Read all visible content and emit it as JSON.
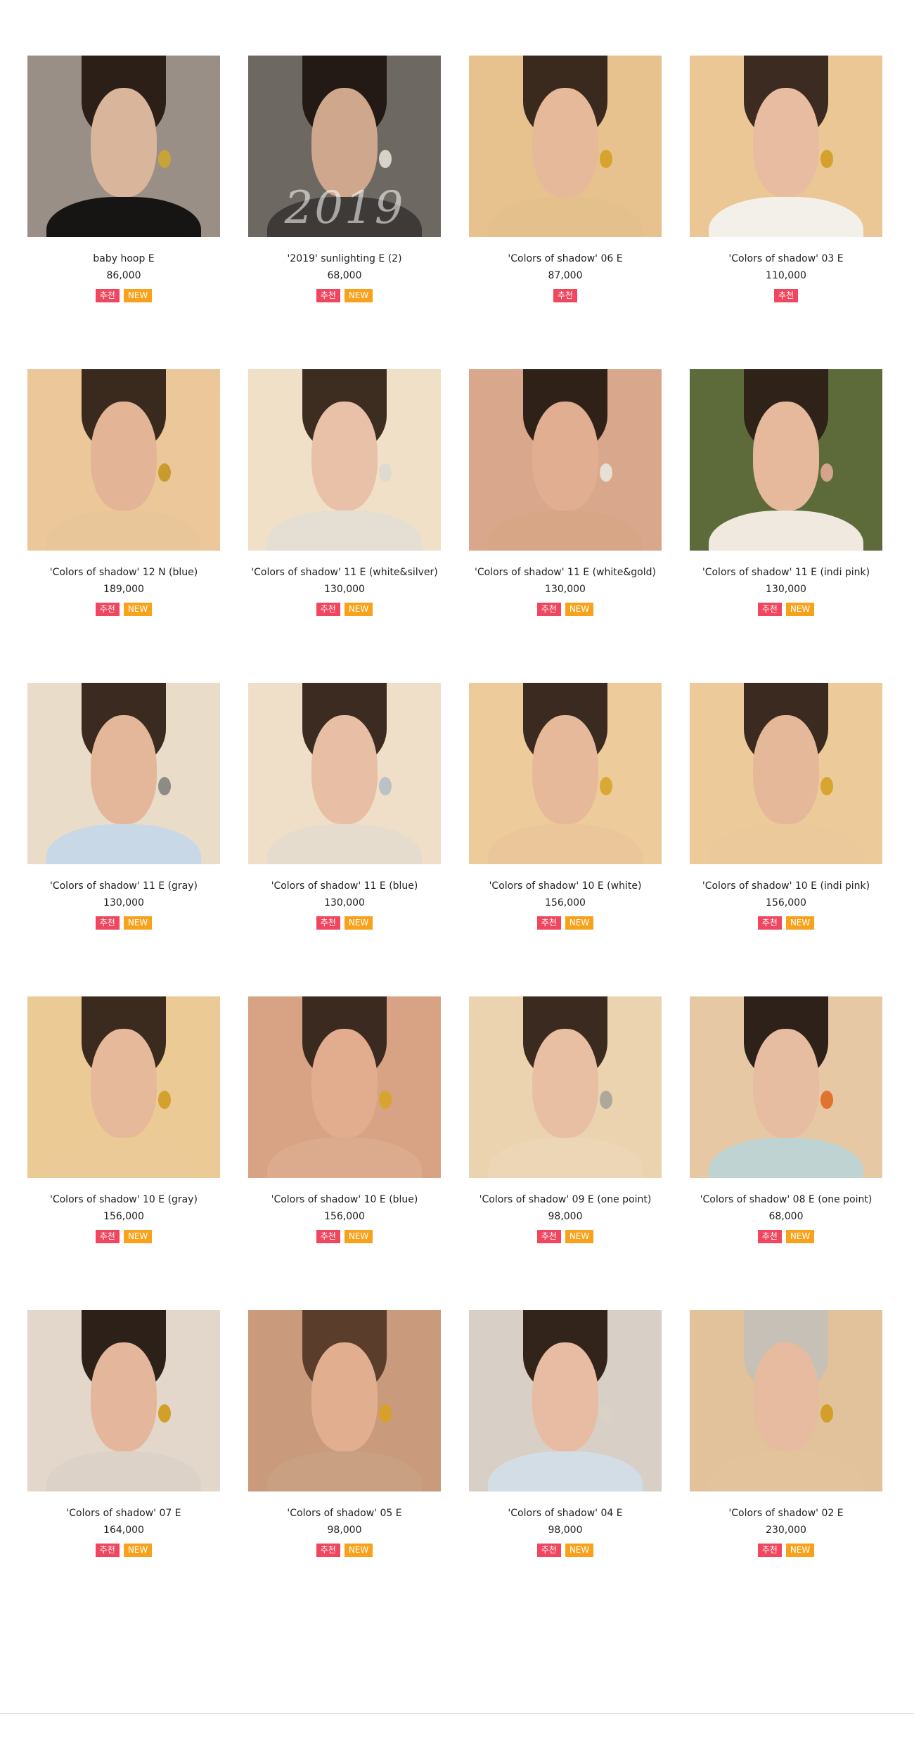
{
  "badges": {
    "recommend": "추천",
    "new": "NEW"
  },
  "products": [
    {
      "name": "baby hoop E",
      "price": "86,000",
      "badges": [
        "rec",
        "new"
      ],
      "bg": "#9a8f86",
      "hair": "#2b1f18",
      "face": "#d9b59c",
      "top": "#161514",
      "earring": "#c9a23a"
    },
    {
      "name": "'2019' sunlighting E (2)",
      "price": "68,000",
      "badges": [
        "rec",
        "new"
      ],
      "bg": "#6e6863",
      "hair": "#231a15",
      "face": "#cfa78d",
      "top": "#3d3a37",
      "earring": "#d8d2c8",
      "overlay": "2019"
    },
    {
      "name": "'Colors of shadow' 06 E",
      "price": "87,000",
      "badges": [
        "rec"
      ],
      "bg": "#e8c28e",
      "hair": "#3a2a1d",
      "face": "#e6b99a",
      "top": "#e4c08d",
      "earring": "#d6a42c"
    },
    {
      "name": "'Colors of shadow' 03 E",
      "price": "110,000",
      "badges": [
        "rec"
      ],
      "bg": "#ebc796",
      "hair": "#3b2b20",
      "face": "#e7bca0",
      "top": "#f3f0ea",
      "earring": "#d4a22a"
    },
    {
      "name": "'Colors of shadow' 12 N (blue)",
      "price": "189,000",
      "badges": [
        "rec",
        "new"
      ],
      "bg": "#ebc79a",
      "hair": "#3a2a1e",
      "face": "#e4b496",
      "top": "#e9c59a",
      "earring": "#c99a2d"
    },
    {
      "name": "'Colors of shadow' 11 E (white&silver)",
      "price": "130,000",
      "badges": [
        "rec",
        "new"
      ],
      "bg": "#efe0c7",
      "hair": "#3d2c20",
      "face": "#e9c1a8",
      "top": "#e4dfd2",
      "earring": "#dfd9cf"
    },
    {
      "name": "'Colors of shadow' 11 E (white&gold)",
      "price": "130,000",
      "badges": [
        "rec",
        "new"
      ],
      "bg": "#d9a88c",
      "hair": "#2f2118",
      "face": "#e2ae91",
      "top": "#d7a687",
      "earring": "#e6e0d6"
    },
    {
      "name": "'Colors of shadow' 11 E (indi pink)",
      "price": "130,000",
      "badges": [
        "rec",
        "new"
      ],
      "bg": "#5d6a3a",
      "hair": "#2f2219",
      "face": "#e6b99d",
      "top": "#efe9e0",
      "earring": "#d3a48c"
    },
    {
      "name": "'Colors of shadow' 11 E (gray)",
      "price": "130,000",
      "badges": [
        "rec",
        "new"
      ],
      "bg": "#e9dcc9",
      "hair": "#3a2a1f",
      "face": "#e4b79b",
      "top": "#c9d8e6",
      "earring": "#8e8a86"
    },
    {
      "name": "'Colors of shadow' 11 E (blue)",
      "price": "130,000",
      "badges": [
        "rec",
        "new"
      ],
      "bg": "#efdfc8",
      "hair": "#3b2b20",
      "face": "#e8bfa5",
      "top": "#e5dccd",
      "earring": "#bcc1c6"
    },
    {
      "name": "'Colors of shadow' 10 E (white)",
      "price": "156,000",
      "badges": [
        "rec",
        "new"
      ],
      "bg": "#eecb9b",
      "hair": "#3a2a1f",
      "face": "#e7b99b",
      "top": "#eac69a",
      "earring": "#d8aa35"
    },
    {
      "name": "'Colors of shadow' 10 E (indi pink)",
      "price": "156,000",
      "badges": [
        "rec",
        "new"
      ],
      "bg": "#ecca99",
      "hair": "#3a2a1f",
      "face": "#e6b89a",
      "top": "#ecc99a",
      "earring": "#d7a52d"
    },
    {
      "name": "'Colors of shadow' 10 E (gray)",
      "price": "156,000",
      "badges": [
        "rec",
        "new"
      ],
      "bg": "#ecca96",
      "hair": "#3b2b1f",
      "face": "#e6b99b",
      "top": "#ecca97",
      "earring": "#d3a12c"
    },
    {
      "name": "'Colors of shadow' 10 E (blue)",
      "price": "156,000",
      "badges": [
        "rec",
        "new"
      ],
      "bg": "#d7a384",
      "hair": "#3a2a1f",
      "face": "#e2ad8f",
      "top": "#dcab8d",
      "earring": "#d6a52f"
    },
    {
      "name": "'Colors of shadow' 09 E (one point)",
      "price": "98,000",
      "badges": [
        "rec",
        "new"
      ],
      "bg": "#ecd3b0",
      "hair": "#3a2a1f",
      "face": "#e9bfa3",
      "top": "#ecd6b6",
      "earring": "#b0a79b"
    },
    {
      "name": "'Colors of shadow' 08 E (one point)",
      "price": "68,000",
      "badges": [
        "rec",
        "new"
      ],
      "bg": "#e6c9a4",
      "hair": "#2e2119",
      "face": "#e7bda2",
      "top": "#bfd4d2",
      "earring": "#e0732e"
    },
    {
      "name": "'Colors of shadow' 07 E",
      "price": "164,000",
      "badges": [
        "rec",
        "new"
      ],
      "bg": "#e3d7cb",
      "hair": "#2d2019",
      "face": "#e4b79c",
      "top": "#ddd2c7",
      "earring": "#d29f2a"
    },
    {
      "name": "'Colors of shadow' 05 E",
      "price": "98,000",
      "badges": [
        "rec",
        "new"
      ],
      "bg": "#c99a7b",
      "hair": "#5a3d2b",
      "face": "#e2ae90",
      "top": "#caa082",
      "earring": "#d6a02a"
    },
    {
      "name": "'Colors of shadow' 04 E",
      "price": "98,000",
      "badges": [
        "rec",
        "new"
      ],
      "bg": "#d8cfc6",
      "hair": "#33241b",
      "face": "#e7bca2",
      "top": "#d3dde6",
      "earring": "#d9d2c9"
    },
    {
      "name": "'Colors of shadow' 02 E",
      "price": "230,000",
      "badges": [
        "rec",
        "new"
      ],
      "bg": "#e2c29b",
      "hair": "#c7c0b6",
      "face": "#e7bb9f",
      "top": "#e3c39c",
      "earring": "#d49f28"
    }
  ]
}
